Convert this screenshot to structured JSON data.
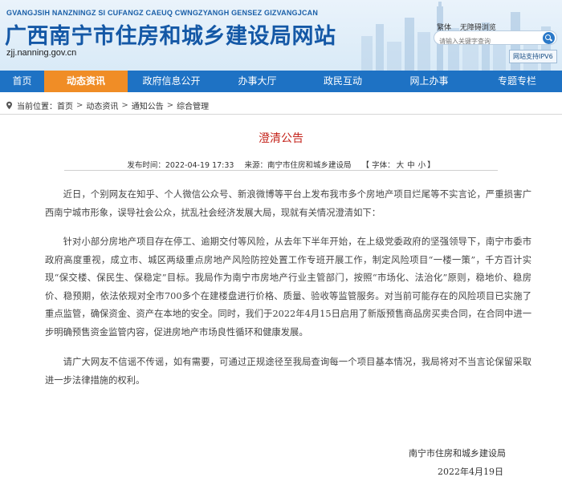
{
  "header": {
    "pinyin": "GVANGJSIH NANZNINGZ SI CUFANGZ CAEUQ CWNGZYANGH GENSEZ GIZVANGJCAN",
    "site_title": "广西南宁市住房和城乡建设局网站",
    "domain": "zjj.nanning.gov.cn",
    "link_traditional": "繁体",
    "link_accessible": "无障碍浏览",
    "search_placeholder": "请输入关键字查询",
    "ipv6_badge": "网站支持IPV6"
  },
  "nav": {
    "items": [
      {
        "label": "首页",
        "active": false
      },
      {
        "label": "动态资讯",
        "active": true
      },
      {
        "label": "政府信息公开",
        "active": false
      },
      {
        "label": "办事大厅",
        "active": false
      },
      {
        "label": "政民互动",
        "active": false
      },
      {
        "label": "网上办事",
        "active": false
      },
      {
        "label": "专题专栏",
        "active": false
      }
    ],
    "active_color": "#f08d26",
    "bar_color": "#1e72c4"
  },
  "breadcrumb": {
    "prefix": "当前位置：",
    "items": [
      "首页",
      "动态资讯",
      "通知公告",
      "综合管理"
    ],
    "separator": ">"
  },
  "article": {
    "title": "澄清公告",
    "title_color": "#c4241c",
    "publish_time": "发布时间：2022-04-19 17:33",
    "source": "来源：南宁市住房和城乡建设局",
    "font_label": "【 字体：",
    "font_large": "大",
    "font_medium": "中",
    "font_small": "小",
    "font_close": "】",
    "paragraphs": [
      "近日，个别网友在知乎、个人微信公众号、新浪微博等平台上发布我市多个房地产项目烂尾等不实言论，严重损害广西南宁城市形象，误导社会公众，扰乱社会经济发展大局，现就有关情况澄清如下：",
      "针对小部分房地产项目存在停工、逾期交付等风险，从去年下半年开始，在上级党委政府的坚强领导下，南宁市委市政府高度重视，成立市、城区两级重点房地产风险防控处置工作专班开展工作，制定风险项目“一楼一策”，千方百计实现“保交楼、保民生、保稳定”目标。我局作为南宁市房地产行业主管部门，按照“市场化、法治化”原则，稳地价、稳房价、稳预期，依法依规对全市700多个在建楼盘进行价格、质量、验收等监管服务。对当前可能存在的风险项目已实施了重点监管，确保资金、资产在本地的安全。同时，我们于2022年4月15日启用了新版预售商品房买卖合同，在合同中进一步明确预售资金监管内容，促进房地产市场良性循环和健康发展。",
      "请广大网友不信谣不传谣，如有需要，可通过正规途径至我局查询每一个项目基本情况，我局将对不当言论保留采取进一步法律措施的权利。"
    ],
    "signature_org": "南宁市住房和城乡建设局",
    "signature_date": "2022年4月19日"
  }
}
